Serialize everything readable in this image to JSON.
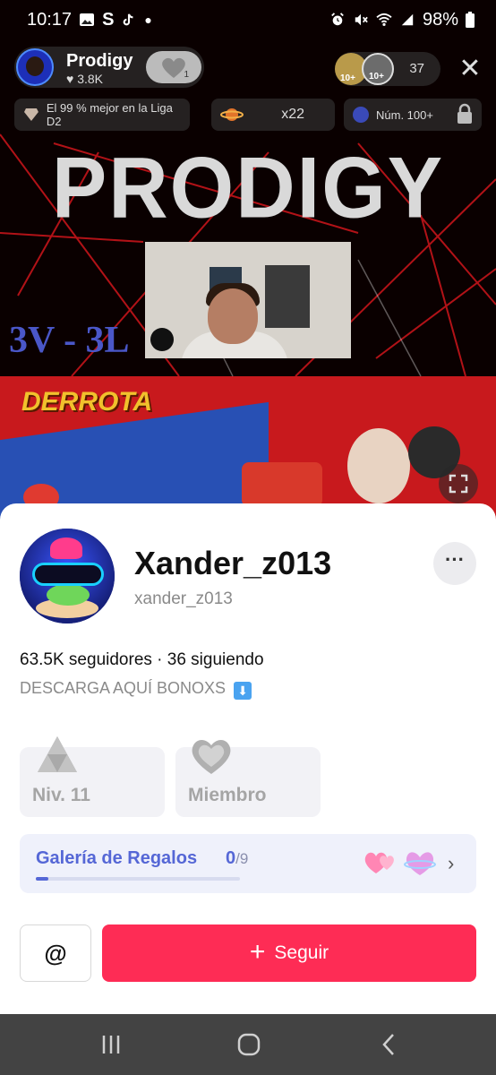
{
  "status_bar": {
    "time": "10:17",
    "battery": "98%"
  },
  "live": {
    "host_name": "Prodigy",
    "host_likes": "♥ 3.8K",
    "host_heart_count": "1",
    "viewer_badges": [
      "10+",
      "10+"
    ],
    "viewer_count": "37",
    "chips": {
      "league": "El 99 % mejor en la Liga D2",
      "multiplier": "x22",
      "rank": "Núm. 100+"
    },
    "banner_title": "PRODIGY",
    "score": "3V - 3L",
    "result": "DERROTA"
  },
  "profile": {
    "username": "Xander_z013",
    "handle": "xander_z013",
    "more_label": "···",
    "stats": "63.5K seguidores · 36 siguiendo",
    "bio": "DESCARGA AQUÍ BONOXS",
    "bio_emoji": "⬇",
    "level_label": "Niv. 11",
    "member_label": "Miembro",
    "gallery": {
      "title": "Galería de Regalos",
      "collected": "0",
      "total": "/9",
      "progress": 0.06
    },
    "mention_label": "@",
    "follow_label": "Seguir",
    "follow_plus": "+"
  },
  "colors": {
    "follow": "#fe2c55",
    "gallery_accent": "#5567d6",
    "card_bg": "#f2f2f6"
  },
  "icons": [
    "image-icon",
    "s-icon",
    "tiktok-icon",
    "alarm-icon",
    "mute-icon",
    "wifi-icon",
    "signal-icon",
    "battery-icon",
    "close-icon",
    "gem-icon",
    "planet-icon",
    "lock-icon",
    "pip-icon",
    "level-triangle-icon",
    "member-heart-icon",
    "gift-hearts-icon",
    "chevron-right-icon",
    "recent-apps-icon",
    "home-icon",
    "back-icon"
  ]
}
